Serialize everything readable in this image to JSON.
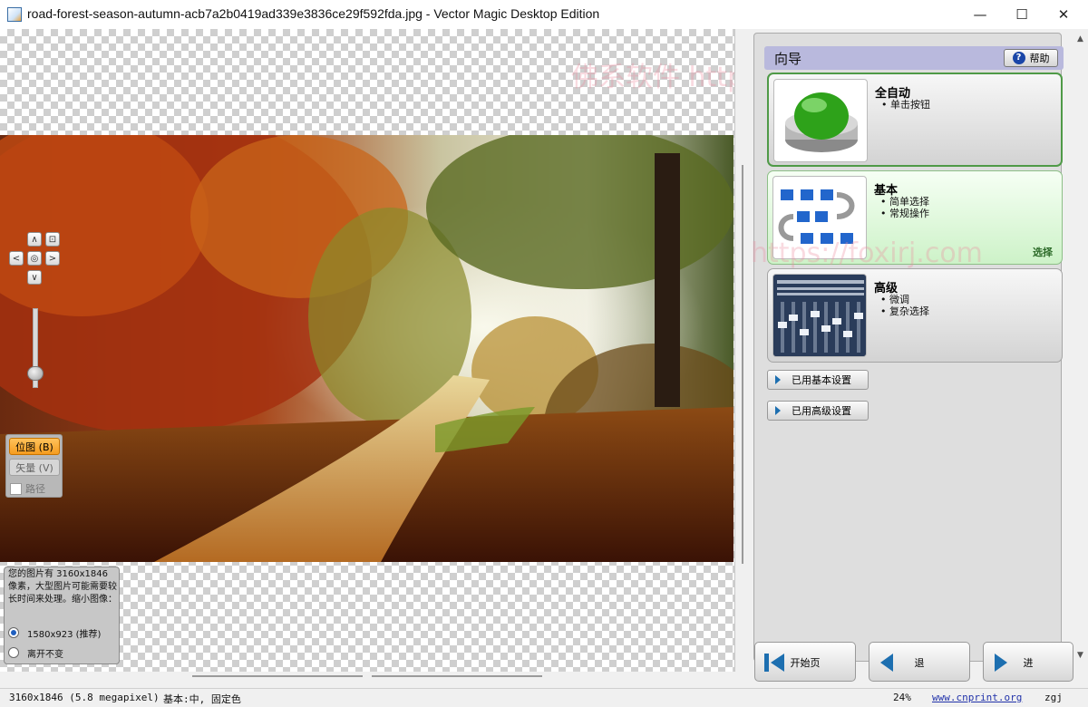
{
  "window": {
    "title": "road-forest-season-autumn-acb7a2b0419ad339e3836ce29f592fda.jpg - Vector Magic Desktop Edition",
    "minimize_glyph": "—",
    "maximize_glyph": "☐",
    "close_glyph": "✕"
  },
  "canvas": {
    "nav_controls": {
      "up": "∧",
      "down": "∨",
      "left": "<",
      "right": ">",
      "center": "◎",
      "fit": "⊡"
    },
    "mode_panel": {
      "bitmap_label": "位图 (B)",
      "vector_label": "矢量 (V)",
      "path_label": "路径"
    },
    "size_prompt": {
      "message": "您的图片有 3160x1846 像素，大型图片可能需要较长时间来处理。缩小图像：",
      "options": [
        {
          "label": "1580x923 (推荐)",
          "selected": true
        },
        {
          "label": "离开不变",
          "selected": false
        }
      ]
    }
  },
  "wizard": {
    "header_title": "向导",
    "help_label": "帮助",
    "help_icon_glyph": "?",
    "cards": [
      {
        "title": "全自动",
        "items": [
          "单击按钮"
        ],
        "select_label": "",
        "icon": "green-button-icon"
      },
      {
        "title": "基本",
        "items": [
          "简单选择",
          "常规操作"
        ],
        "select_label": "选择",
        "icon": "flowchart-icon"
      },
      {
        "title": "高级",
        "items": [
          "微调",
          "复杂选择"
        ],
        "select_label": "",
        "icon": "mixer-icon"
      }
    ],
    "basic_settings_label": "已用基本设置",
    "advanced_settings_label": "已用高级设置",
    "nav": {
      "home_label": "开始页",
      "back_label": "退",
      "next_label": "进"
    }
  },
  "status_bar": {
    "image_info": "3160x1846 (5.8 megapixel)",
    "mode_info": "基本:中, 固定色",
    "zoom": "24%",
    "link": "www.cnprint.org",
    "user": "zgj"
  },
  "watermarks": [
    "佛系软件 https://foxirj.com",
    "https://foxirj.com"
  ],
  "colors": {
    "accent_orange": "#f59c20",
    "header_purple": "#b9b9dd",
    "link_blue": "#2233aa"
  }
}
